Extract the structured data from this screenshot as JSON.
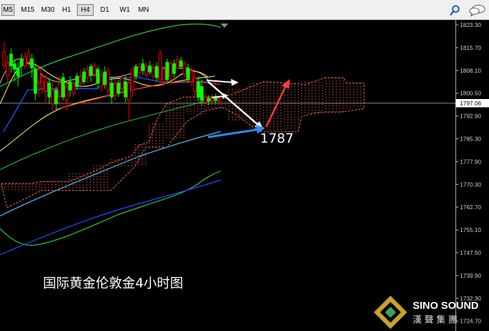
{
  "toolbar": {
    "timeframes": [
      {
        "label": "M5",
        "active": true
      },
      {
        "label": "M15",
        "active": false
      },
      {
        "label": "M30",
        "active": false
      },
      {
        "label": "H1",
        "active": false
      },
      {
        "label": "H4",
        "active": true
      },
      {
        "label": "D1",
        "active": false
      },
      {
        "label": "W1",
        "active": false
      },
      {
        "label": "MN",
        "active": false
      }
    ],
    "icons": [
      "search-icon",
      "chat-bubbles-icon"
    ]
  },
  "price_axis": {
    "labels": [
      "1823.30",
      "1815.70",
      "1808.10",
      "1800.50",
      "1792.90",
      "1785.30",
      "1777.90",
      "1770.30",
      "1762.70",
      "1755.10",
      "1747.50",
      "1739.90",
      "1732.30",
      "1724.70"
    ],
    "current_price": "1797.06"
  },
  "annotations": {
    "target_label": "1787",
    "chart_caption": "国际黄金伦敦金4小时图"
  },
  "watermark": {
    "brand": "SINO SOUND",
    "brand_chinese": "漢 聲 集 團"
  },
  "colors": {
    "background": "#000000",
    "candle_up": "#00ff00",
    "candle_down": "#ff0000",
    "cloud": "#ff6a4d",
    "arrow_white": "#ffffff",
    "arrow_red": "#ff3c3c",
    "arrow_blue": "#2a8cff"
  }
}
